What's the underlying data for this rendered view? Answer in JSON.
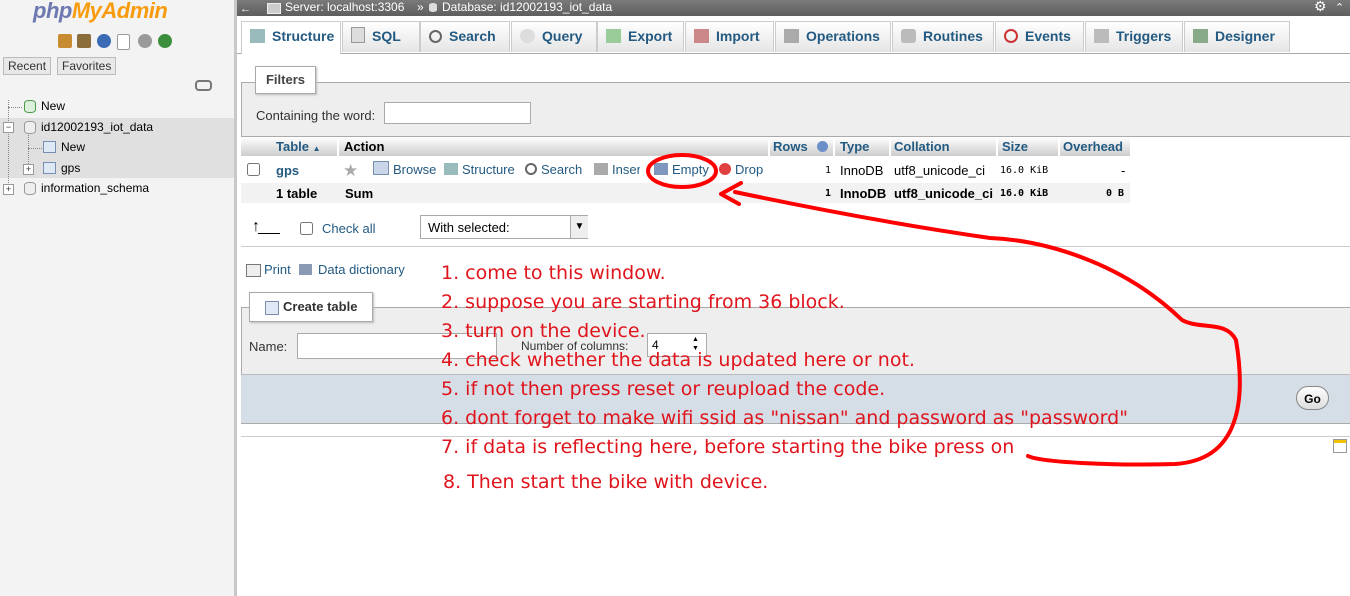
{
  "nav": {
    "logo_left": "php",
    "logo_right": "MyAdmin",
    "recent_label": "Recent",
    "favorites_label": "Favorites",
    "tree": {
      "new_label": "New",
      "db1": "id12002193_iot_data",
      "db1_new": "New",
      "db1_table": "gps",
      "db2": "information_schema"
    }
  },
  "topbar": {
    "server": "Server: localhost:3306",
    "sep": "»",
    "database": "Database: id12002193_iot_data"
  },
  "tabs": [
    "Structure",
    "SQL",
    "Search",
    "Query",
    "Export",
    "Import",
    "Operations",
    "Routines",
    "Events",
    "Triggers",
    "Designer"
  ],
  "filters": {
    "legend": "Filters",
    "label": "Containing the word:",
    "value": ""
  },
  "table": {
    "headers": {
      "table": "Table",
      "action": "Action",
      "rows": "Rows",
      "type": "Type",
      "collation": "Collation",
      "size": "Size",
      "overhead": "Overhead"
    },
    "row": {
      "name": "gps",
      "actions": [
        "Browse",
        "Structure",
        "Search",
        "Insert",
        "Empty",
        "Drop"
      ],
      "rows": "1",
      "type": "InnoDB",
      "collation": "utf8_unicode_ci",
      "size": "16.0 KiB",
      "overhead": "-"
    },
    "sum": {
      "name": "1 table",
      "label": "Sum",
      "rows": "1",
      "type": "InnoDB",
      "collation": "utf8_unicode_ci",
      "size": "16.0 KiB",
      "overhead": "0 B"
    }
  },
  "bulk": {
    "check_all": "Check all",
    "with_selected": "With selected:"
  },
  "links": {
    "print": "Print",
    "data_dictionary": "Data dictionary"
  },
  "create": {
    "legend": "Create table",
    "name_label": "Name:",
    "name_value": "",
    "columns_label": "Number of columns:",
    "columns_value": "4",
    "go": "Go"
  },
  "annotations": [
    "1. come to this window.",
    "2. suppose you are starting from 36 block.",
    "3. turn on the device.",
    "4. check whether the data is updated here or not.",
    "5. if not then press reset or reupload the code.",
    "6. dont forget to make wifi ssid as \"nissan\" and password as \"password\"",
    "7. if data is reflecting here, before starting the bike press on",
    "8. Then start the bike with device."
  ],
  "colors": {
    "link": "#235a81",
    "annotation": "#e0141c",
    "topbar": "#6a6a6a"
  }
}
